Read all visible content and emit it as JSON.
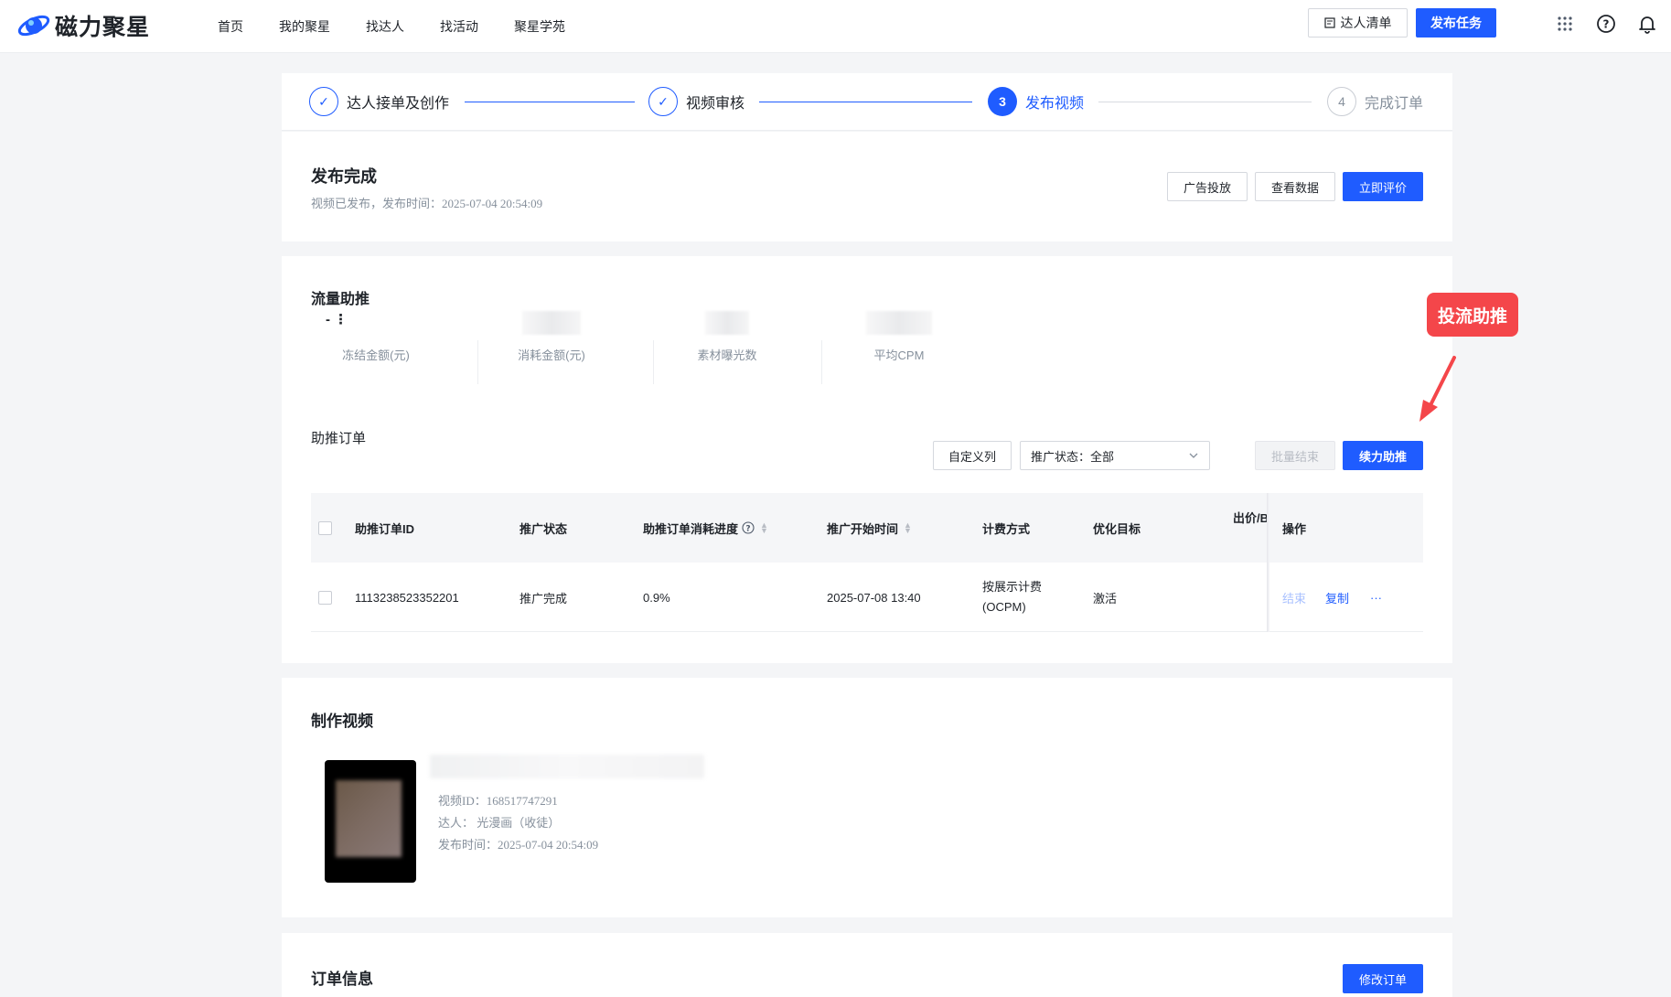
{
  "header": {
    "brand": "磁力聚星",
    "nav": [
      "首页",
      "我的聚星",
      "找达人",
      "找活动",
      "聚星学苑"
    ],
    "talent_list": "达人清单",
    "publish_task": "发布任务",
    "icons": [
      "apps-grid-icon",
      "help-icon",
      "bell-icon"
    ]
  },
  "steps": [
    {
      "label": "达人接单及创作",
      "state": "done",
      "marker": "✓"
    },
    {
      "label": "视频审核",
      "state": "done",
      "marker": "✓"
    },
    {
      "label": "发布视频",
      "state": "active",
      "marker": "3"
    },
    {
      "label": "完成订单",
      "state": "todo",
      "marker": "4"
    }
  ],
  "publish": {
    "title": "发布完成",
    "subtitle": "视频已发布，发布时间：2025-07-04 20:54:09",
    "btn_ad": "广告投放",
    "btn_data": "查看数据",
    "btn_review": "立即评价"
  },
  "traffic": {
    "title": "流量助推",
    "stats": [
      {
        "value": "- ⋮",
        "label": "冻结金额(元)"
      },
      {
        "value": "",
        "label": "消耗金额(元)"
      },
      {
        "value": "",
        "label": "素材曝光数"
      },
      {
        "value": "",
        "label": "平均CPM"
      }
    ],
    "orders_title": "助推订单",
    "custom_columns": "自定义列",
    "status_filter": "推广状态：全部",
    "batch_end": "批量结束",
    "continue_boost": "续力助推",
    "columns": [
      "助推订单ID",
      "推广状态",
      "助推订单消耗进度",
      "推广开始时间",
      "计费方式",
      "优化目标",
      "出价/B",
      "操作"
    ],
    "rows": [
      {
        "id": "1113238523352201",
        "status": "推广完成",
        "progress": "0.9%",
        "start_time": "2025-07-08 13:40",
        "billing_line1": "按展示计费",
        "billing_line2": "(OCPM)",
        "target": "激活",
        "op_end": "结束",
        "op_copy": "复制",
        "op_more": "···"
      }
    ]
  },
  "video": {
    "title": "制作视频",
    "video_id": "视频ID：168517747291",
    "talent": "达人：         光漫画（收徒）",
    "publish_time": "发布时间：2025-07-04 20:54:09"
  },
  "order": {
    "title": "订单信息",
    "modify": "修改订单"
  },
  "annotation": {
    "label": "投流助推",
    "color": "#f4464a"
  },
  "colors": {
    "primary": "#1f5cff",
    "annotation": "#f4464a"
  }
}
